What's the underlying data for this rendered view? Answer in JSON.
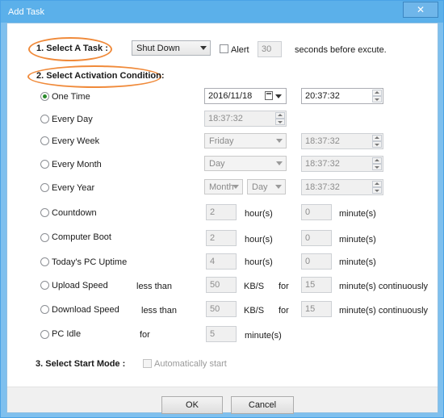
{
  "window": {
    "title": "Add Task",
    "close_label": "✕"
  },
  "section1": {
    "title": "1. Select A Task :",
    "task_select": "Shut Down",
    "alert_label": "Alert",
    "alert_seconds": "30",
    "suffix": "seconds before excute."
  },
  "section2": {
    "title": "2. Select Activation Condition:"
  },
  "one_time": {
    "label": "One Time",
    "date": "2016/11/18",
    "time": "20:37:32"
  },
  "every_day": {
    "label": "Every Day",
    "time": "18:37:32"
  },
  "every_week": {
    "label": "Every Week",
    "day": "Friday",
    "time": "18:37:32"
  },
  "every_month": {
    "label": "Every Month",
    "day": "Day",
    "time": "18:37:32"
  },
  "every_year": {
    "label": "Every Year",
    "month": "Month",
    "day": "Day",
    "time": "18:37:32"
  },
  "countdown": {
    "label": "Countdown",
    "hours": "2",
    "hours_unit": "hour(s)",
    "minutes": "0",
    "minutes_unit": "minute(s)"
  },
  "computer_boot": {
    "label": "Computer Boot",
    "hours": "2",
    "hours_unit": "hour(s)",
    "minutes": "0",
    "minutes_unit": "minute(s)"
  },
  "pc_uptime": {
    "label": "Today's PC Uptime",
    "hours": "4",
    "hours_unit": "hour(s)",
    "minutes": "0",
    "minutes_unit": "minute(s)"
  },
  "upload_speed": {
    "label": "Upload Speed",
    "less_than": "less than",
    "speed": "50",
    "speed_unit": "KB/S",
    "for_label": "for",
    "minutes": "15",
    "suffix": "minute(s)  continuously"
  },
  "download_speed": {
    "label": "Download Speed",
    "less_than": "less than",
    "speed": "50",
    "speed_unit": "KB/S",
    "for_label": "for",
    "minutes": "15",
    "suffix": "minute(s) continuously"
  },
  "pc_idle": {
    "label": "PC Idle",
    "for_label": "for",
    "minutes": "5",
    "minutes_unit": "minute(s)"
  },
  "section3": {
    "title": "3. Select Start Mode :",
    "auto_label": "Automatically start"
  },
  "footer": {
    "ok_label": "OK",
    "cancel_label": "Cancel"
  }
}
